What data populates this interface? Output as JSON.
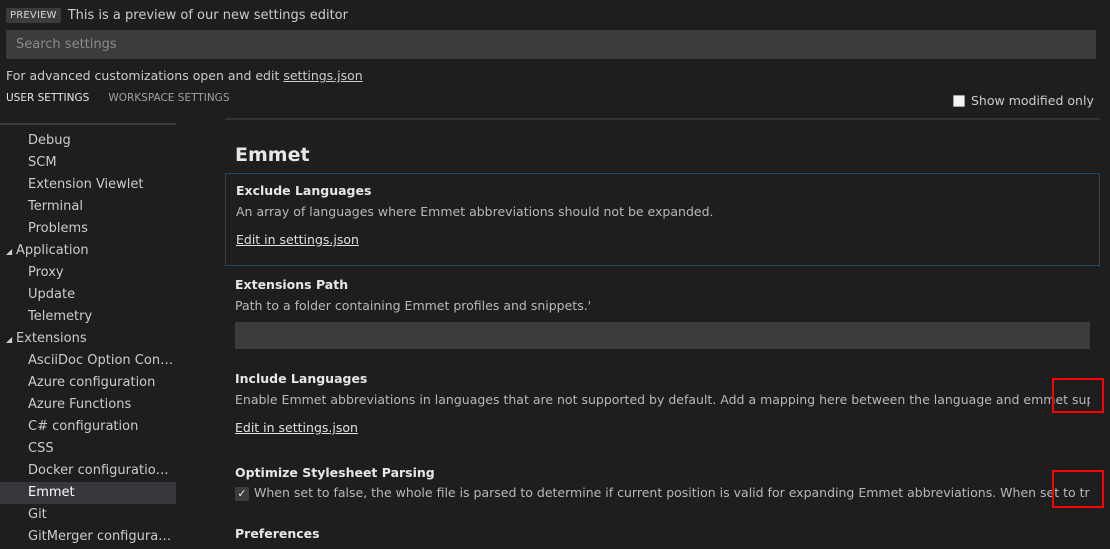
{
  "preview": {
    "badge": "PREVIEW",
    "text": "This is a preview of our new settings editor"
  },
  "search": {
    "placeholder": "Search settings"
  },
  "advanced": {
    "prefix": "For advanced customizations open and edit ",
    "link": "settings.json"
  },
  "tabs": [
    {
      "label": "USER SETTINGS",
      "active": true
    },
    {
      "label": "WORKSPACE SETTINGS",
      "active": false
    }
  ],
  "modified_only": {
    "label": "Show modified only",
    "checked": false
  },
  "tree": [
    {
      "label": "Debug",
      "group": false
    },
    {
      "label": "SCM",
      "group": false
    },
    {
      "label": "Extension Viewlet",
      "group": false
    },
    {
      "label": "Terminal",
      "group": false
    },
    {
      "label": "Problems",
      "group": false
    },
    {
      "label": "Application",
      "group": true
    },
    {
      "label": "Proxy",
      "group": false
    },
    {
      "label": "Update",
      "group": false
    },
    {
      "label": "Telemetry",
      "group": false
    },
    {
      "label": "Extensions",
      "group": true
    },
    {
      "label": "AsciiDoc Option Configu...",
      "group": false
    },
    {
      "label": "Azure configuration",
      "group": false
    },
    {
      "label": "Azure Functions",
      "group": false
    },
    {
      "label": "C# configuration",
      "group": false
    },
    {
      "label": "CSS",
      "group": false
    },
    {
      "label": "Docker configuration op...",
      "group": false
    },
    {
      "label": "Emmet",
      "group": false,
      "selected": true
    },
    {
      "label": "Git",
      "group": false
    },
    {
      "label": "GitMerger configuration",
      "group": false
    }
  ],
  "section": {
    "title": "Emmet"
  },
  "settings": {
    "exclude": {
      "title": "Exclude Languages",
      "desc": "An array of languages where Emmet abbreviations should not be expanded.",
      "edit": "Edit in settings.json"
    },
    "extensions_path": {
      "title": "Extensions Path",
      "desc": "Path to a folder containing Emmet profiles and snippets.'"
    },
    "include": {
      "title": "Include Languages",
      "desc": "Enable Emmet abbreviations in languages that are not supported by default. Add a mapping here between the language and emmet supported lan...",
      "edit": "Edit in settings.json"
    },
    "optimize": {
      "title": "Optimize Stylesheet Parsing",
      "checked": true,
      "desc": "When set to false, the whole file is parsed to determine if current position is valid for expanding Emmet abbreviations. When set to true, only the..."
    },
    "preferences": {
      "title": "Preferences"
    }
  },
  "colors": {
    "background": "#1e1e1e",
    "highlight_box": "#ff0000",
    "selected_row": "#37373d"
  }
}
